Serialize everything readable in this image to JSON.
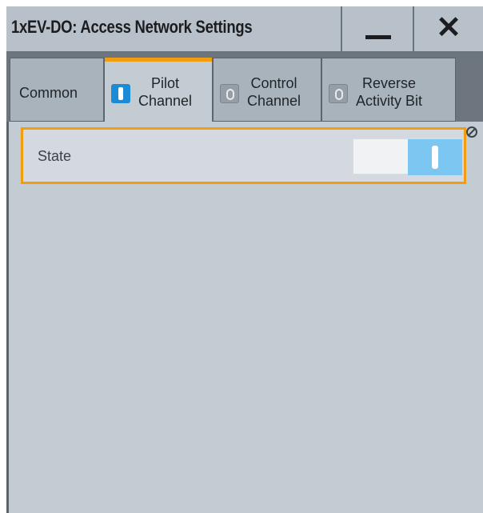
{
  "window": {
    "title": "1xEV-DO: Access Network Settings",
    "minimize_icon": "minimize-icon",
    "close_icon": "close-icon",
    "close_glyph": "✕"
  },
  "tabs": [
    {
      "label": "Common",
      "active": false,
      "checkbox": null
    },
    {
      "label_line1": "Pilot",
      "label_line2": "Channel",
      "active": true,
      "checkbox": "on"
    },
    {
      "label_line1": "Control",
      "label_line2": "Channel",
      "active": false,
      "checkbox": "off"
    },
    {
      "label_line1": "Reverse",
      "label_line2": "Activity Bit",
      "active": false,
      "checkbox": "off"
    }
  ],
  "state": {
    "label": "State",
    "value": "on"
  },
  "colors": {
    "accent": "#f29c10",
    "checkbox_on": "#1c8bd6",
    "toggle_on": "#7cc7f2"
  }
}
